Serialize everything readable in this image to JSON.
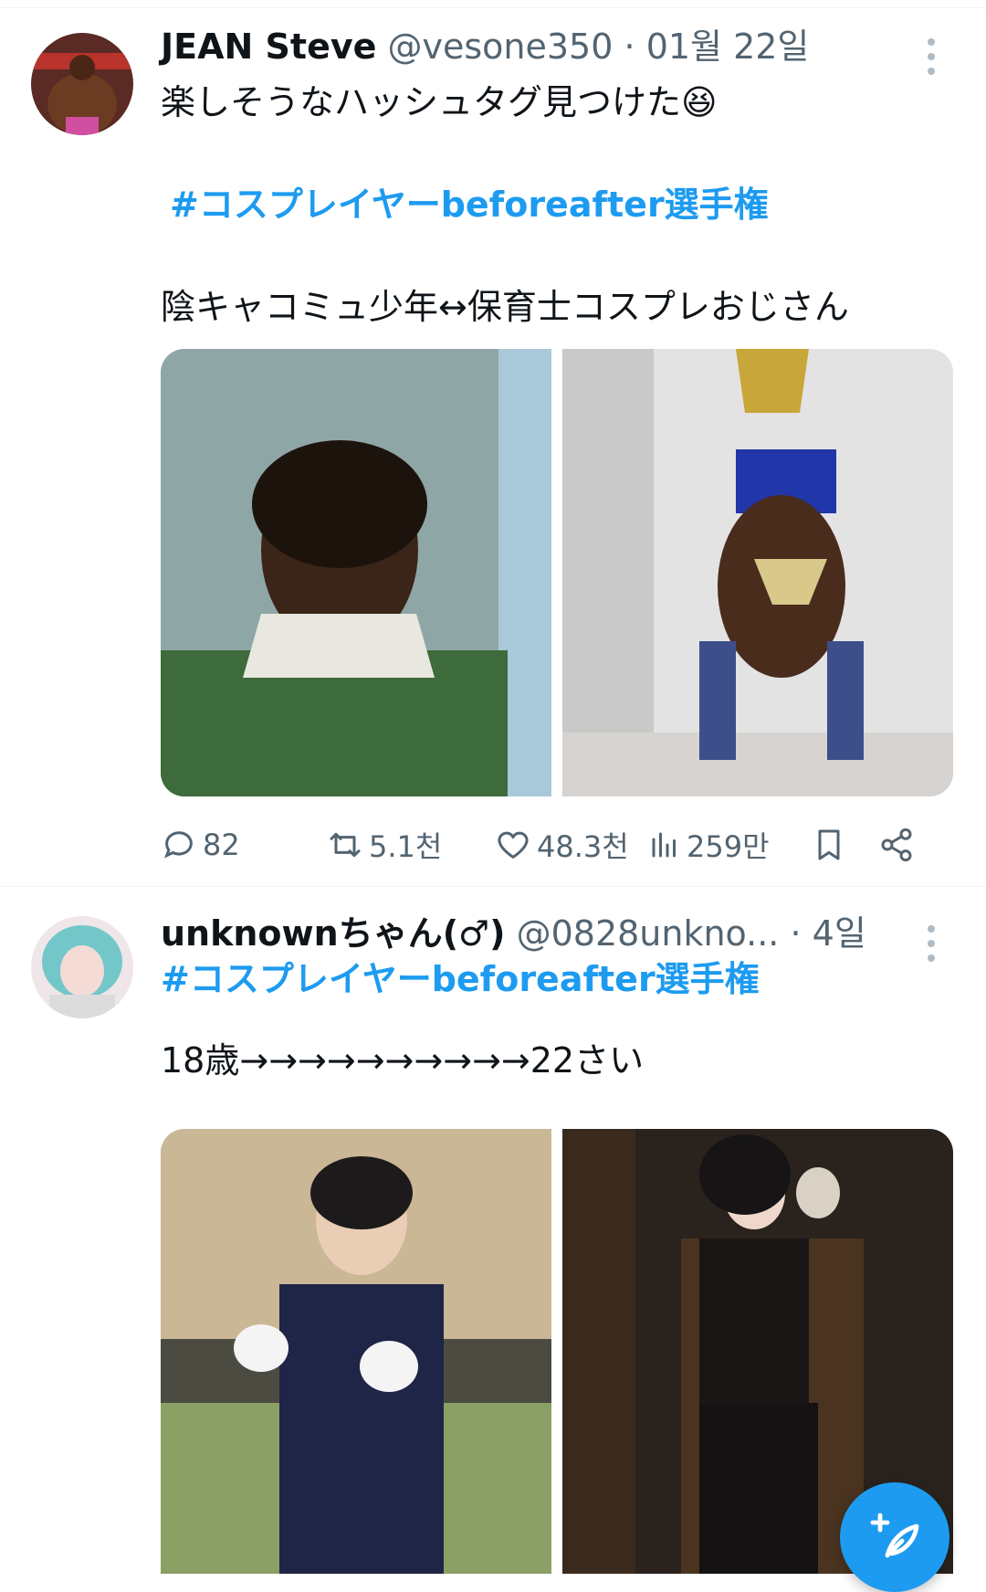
{
  "tweets": [
    {
      "name": "JEAN Steve",
      "handle": "@vesone350",
      "separator": "·",
      "time": "01월 22일",
      "line1": "楽しそうなハッシュタグ見つけた😆",
      "hashtag": "#コスプレイヤーbeforeafter選手権",
      "line2": "陰キャコミュ少年↔保育士コスプレおじさん",
      "stats": {
        "replies": "82",
        "retweets": "5.1천",
        "likes": "48.3천",
        "views": "259만"
      }
    },
    {
      "name": "unknownちゃん(♂)",
      "handle": "@0828unkno...",
      "separator": "·",
      "time": "4일",
      "hashtag": "#コスプレイヤーbeforeafter選手権",
      "line2": "18歳→→→→→→→→→→22さい"
    }
  ],
  "icons": {
    "reply": "reply-icon",
    "retweet": "retweet-icon",
    "like": "heart-icon",
    "views": "views-icon",
    "bookmark": "bookmark-icon",
    "share": "share-icon",
    "more": "more-icon",
    "compose": "compose-icon"
  },
  "colors": {
    "accent": "#1d9bf0",
    "text": "#0f1419",
    "secondary": "#536471"
  }
}
